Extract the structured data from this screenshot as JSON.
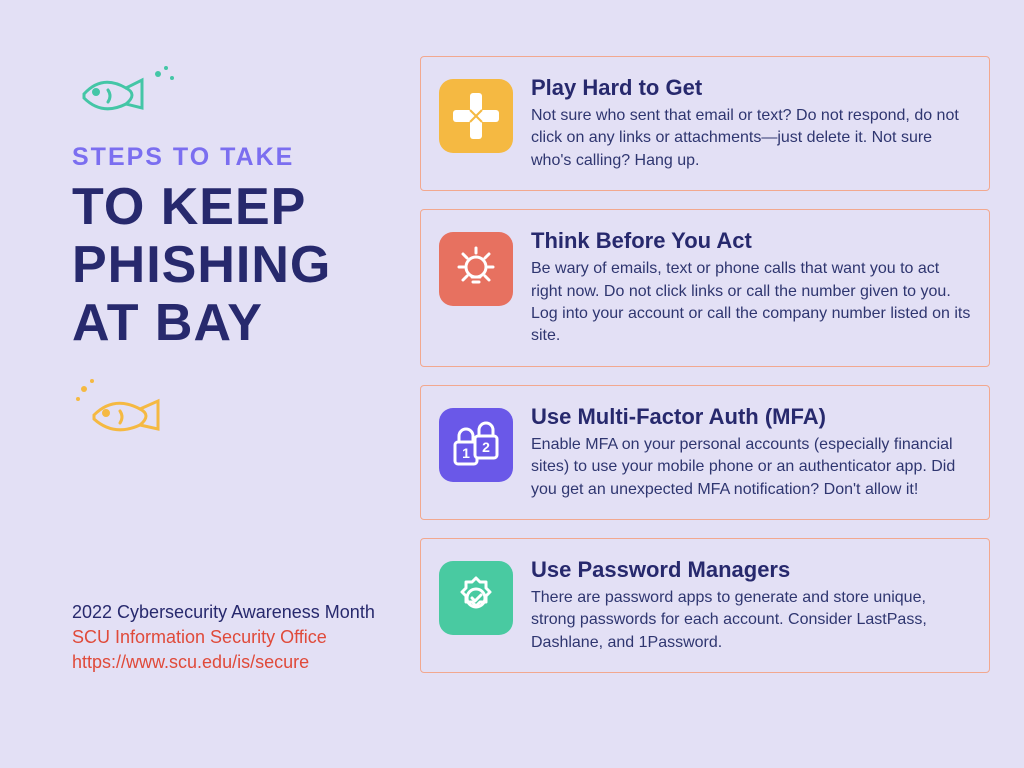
{
  "header": {
    "line1": "Steps to Take",
    "line2": "To Keep Phishing at Bay"
  },
  "footer": {
    "campaign": "2022 Cybersecurity Awareness Month",
    "office": "SCU Information Security Office",
    "url": "https://www.scu.edu/is/secure"
  },
  "cards": [
    {
      "icon": "gamepad-icon",
      "color": "yellow",
      "title": "Play Hard to Get",
      "text": "Not sure who sent that email or text? Do not respond, do not click on any links or attachments—just delete it. Not sure who's calling? Hang up."
    },
    {
      "icon": "lightbulb-icon",
      "color": "coral",
      "title": "Think Before You Act",
      "text": "Be wary of emails, text or phone calls that want you to act right now. Do not click links or call the number given to you. Log into your account or call the company number listed on its site."
    },
    {
      "icon": "padlock-icon",
      "color": "purple",
      "title": "Use Multi-Factor Auth (MFA)",
      "text": "Enable MFA on your personal accounts (especially financial sites) to use your mobile phone or an authenticator app. Did you get an unexpected MFA notification? Don't allow it!"
    },
    {
      "icon": "gear-check-icon",
      "color": "teal",
      "title": "Use Password Managers",
      "text": "There are password apps to generate and store unique, strong passwords for each account. Consider LastPass, Dashlane, and 1Password."
    }
  ]
}
